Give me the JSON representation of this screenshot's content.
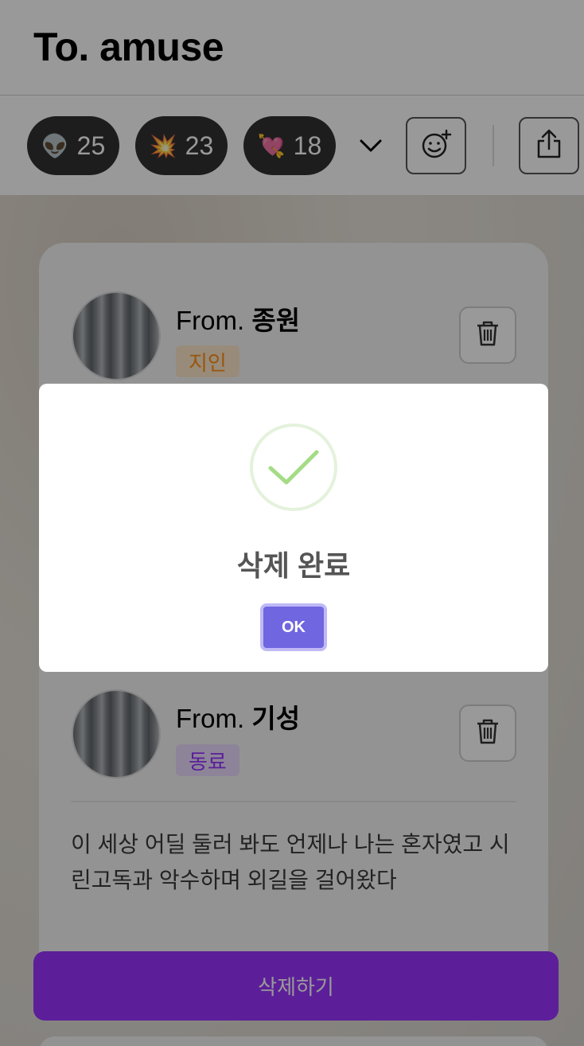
{
  "header": {
    "title": "To. amuse"
  },
  "toolbar": {
    "reactions": [
      {
        "emoji": "👽",
        "count": "25"
      },
      {
        "emoji": "💥",
        "count": "23"
      },
      {
        "emoji": "💘",
        "count": "18"
      }
    ],
    "icons": {
      "expand": "chevron-down-icon",
      "add_reaction": "smiley-plus-icon",
      "share": "share-icon"
    }
  },
  "cards": [
    {
      "from_prefix": "From. ",
      "from_name": "종원",
      "relation": "지인"
    },
    {
      "from_prefix": "From. ",
      "from_name": "기성",
      "relation": "동료",
      "message": "이 세상 어딜 둘러 봐도 언제나 나는 혼자였고 시린고독과 악수하며 외길을 걸어왔다"
    }
  ],
  "delete_button": {
    "label": "삭제하기"
  },
  "modal": {
    "title": "삭제 완료",
    "ok_label": "OK"
  },
  "colors": {
    "primary": "#9935ff",
    "modal_button": "#7066e0",
    "success": "#a5dc86",
    "tag_orange": "#ff8f16",
    "tag_purple": "#9935ff"
  }
}
